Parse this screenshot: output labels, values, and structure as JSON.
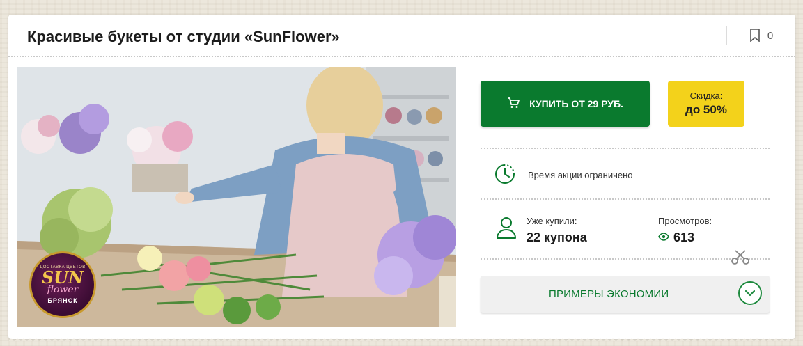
{
  "title": "Красивые букеты от студии «SunFlower»",
  "bookmark": {
    "icon": "bookmark-icon",
    "count": "0"
  },
  "photo": {
    "logo": {
      "top_text": "ДОСТАВКА ЦВЕТОВ",
      "brand1": "SUN",
      "brand2": "flower",
      "city": "БРЯНСК"
    }
  },
  "buy": {
    "label": "КУПИТЬ ОТ 29 РУБ.",
    "icon": "cart-icon"
  },
  "discount": {
    "label": "Скидка:",
    "value": "до 50%"
  },
  "timer": {
    "icon": "clock-icon",
    "text": "Время акции ограничено"
  },
  "stats": {
    "bought_label": "Уже купили:",
    "bought_value": "22 купона",
    "views_label": "Просмотров:",
    "views_value": "613"
  },
  "savings": {
    "label": "ПРИМЕРЫ ЭКОНОМИИ",
    "icon": "chevron-down-icon"
  },
  "colors": {
    "green": "#0a7a2e",
    "yellow": "#f3d21b"
  }
}
